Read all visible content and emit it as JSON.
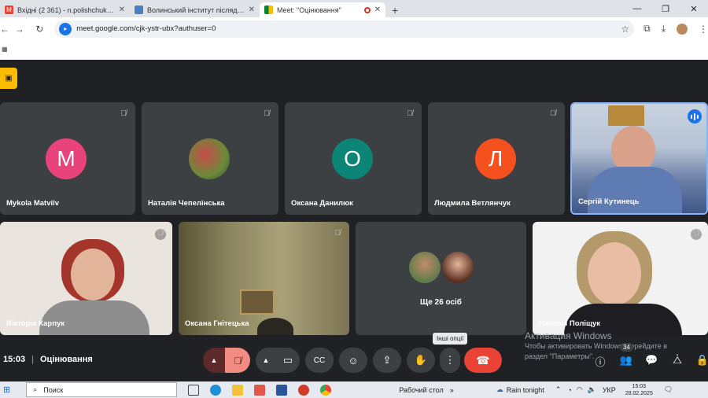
{
  "browser": {
    "tabs": [
      {
        "title": "Вхідні (2 361) - n.polishchuk@v",
        "icon": "gmail-icon"
      },
      {
        "title": "Волинський інститут післядипл",
        "icon": "site-icon"
      },
      {
        "title": "Meet: \"Оцінювання\"",
        "icon": "meet-icon",
        "recording": true
      }
    ],
    "url": "meet.google.com/cjk-ystr-ubx?authuser=0"
  },
  "tiles": [
    {
      "name": "Mykola Matviiv",
      "letter": "M",
      "color": "#e8437a"
    },
    {
      "name": "Наталія Чепелінська",
      "letter": "",
      "color": ""
    },
    {
      "name": "Оксана Данилюк",
      "letter": "O",
      "color": "#0c8577"
    },
    {
      "name": "Людмила Ветлянчук",
      "letter": "Л",
      "color": "#f4511e"
    },
    {
      "name": "Сергій Кутинець",
      "letter": "",
      "color": ""
    },
    {
      "name": "Вікторія Карпук",
      "letter": "",
      "color": ""
    },
    {
      "name": "Оксана Гнітецька",
      "letter": "",
      "color": ""
    },
    {
      "name": "Ще 26 осіб",
      "letter": "",
      "color": ""
    },
    {
      "name": "Наталія Поліщук",
      "letter": "",
      "color": ""
    }
  ],
  "meeting": {
    "time": "15:03",
    "title": "Оцінювання",
    "tooltip": "Інші опції",
    "participants_count": "34"
  },
  "activation": {
    "heading": "Активация Windows",
    "line1": "Чтобы активировать Windows, перейдите в",
    "line2": "раздел \"Параметры\"."
  },
  "taskbar": {
    "search": "Поиск",
    "desktop": "Рабочий стол",
    "weather": "Rain tonight",
    "lang": "УКР",
    "time": "15:03",
    "date": "28.02.2025"
  },
  "colors": {
    "accent": "#1a73e8",
    "hangup": "#ea4335",
    "mic_off": "#ea4335"
  }
}
